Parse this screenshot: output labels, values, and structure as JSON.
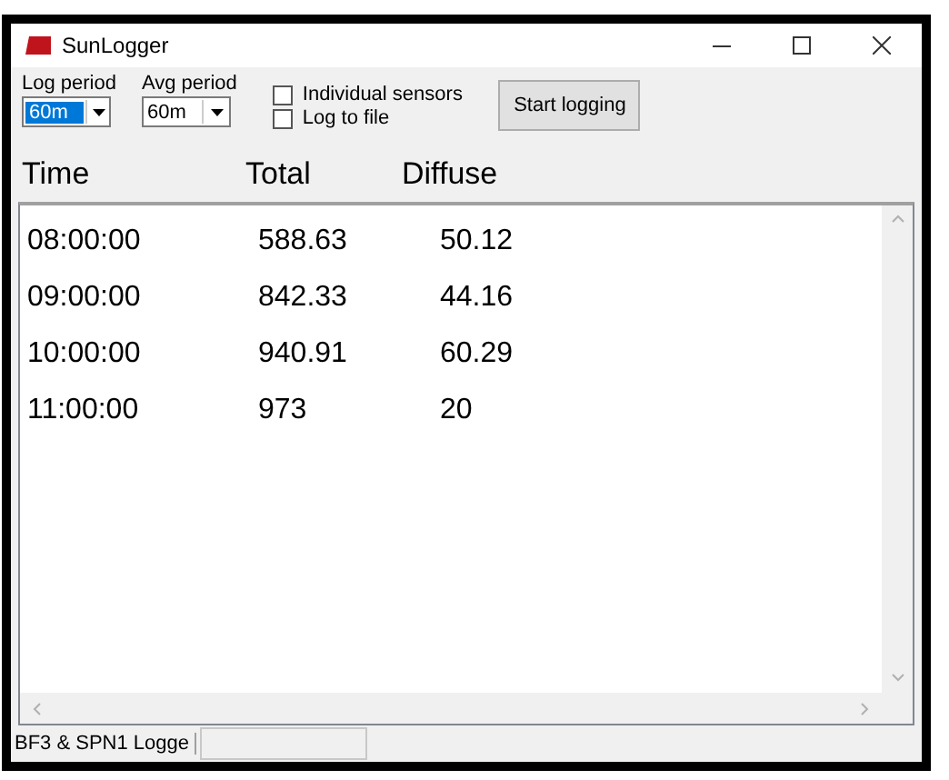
{
  "window": {
    "title": "SunLogger"
  },
  "toolbar": {
    "dropdowns": [
      {
        "label": "Log period",
        "value": "60m",
        "focused": true
      },
      {
        "label": "Avg period",
        "value": "60m",
        "focused": false
      }
    ],
    "checkboxes": [
      {
        "label": "Individual sensors",
        "checked": false
      },
      {
        "label": "Log to file",
        "checked": false
      }
    ],
    "button": "Start logging"
  },
  "table": {
    "columns": [
      "Time",
      "Total",
      "Diffuse"
    ],
    "rows": [
      [
        "08:00:00",
        "588.63",
        "50.12"
      ],
      [
        "09:00:00",
        "842.33",
        "44.16"
      ],
      [
        "10:00:00",
        "940.91",
        "60.29"
      ],
      [
        "11:00:00",
        "973",
        "20"
      ]
    ]
  },
  "status_bar": {
    "text": "BF3 & SPN1 Logge"
  }
}
